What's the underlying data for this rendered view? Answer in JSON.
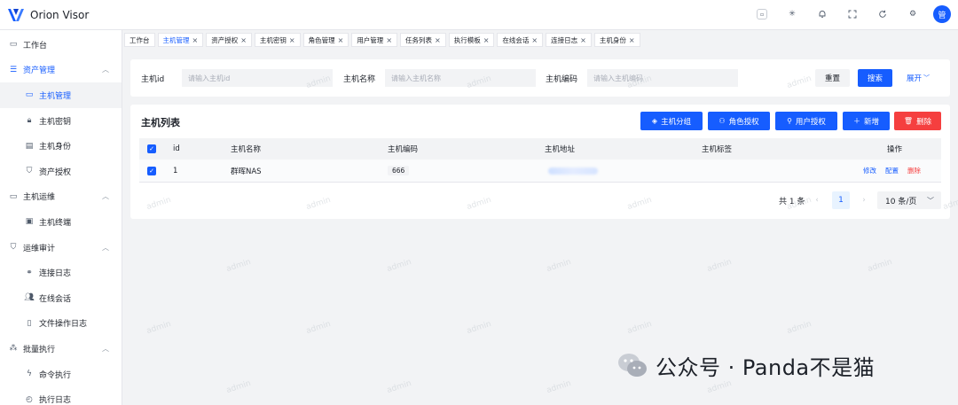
{
  "app": {
    "title": "Orion Visor",
    "avatar_text": "管",
    "brand_color": "#165dff"
  },
  "topbar_icons": [
    "window-icon",
    "sun-icon",
    "bell-icon",
    "fullscreen-icon",
    "refresh-icon",
    "gear-icon"
  ],
  "sidebar": {
    "workbench": "工作台",
    "asset_group": "资产管理",
    "asset_items": [
      "主机管理",
      "主机密钥",
      "主机身份",
      "资产授权"
    ],
    "ops_group": "主机运维",
    "ops_items": [
      "主机终端"
    ],
    "audit_group": "运维审计",
    "audit_items": [
      "连接日志",
      "在线会话",
      "文件操作日志"
    ],
    "batch_group": "批量执行",
    "batch_items": [
      "命令执行",
      "执行日志"
    ]
  },
  "tabs": [
    {
      "label": "工作台",
      "closable": false
    },
    {
      "label": "主机管理",
      "closable": true,
      "active": true
    },
    {
      "label": "资产授权",
      "closable": true
    },
    {
      "label": "主机密钥",
      "closable": true
    },
    {
      "label": "角色管理",
      "closable": true
    },
    {
      "label": "用户管理",
      "closable": true
    },
    {
      "label": "任务列表",
      "closable": true
    },
    {
      "label": "执行模板",
      "closable": true
    },
    {
      "label": "在线会话",
      "closable": true
    },
    {
      "label": "连接日志",
      "closable": true
    },
    {
      "label": "主机身份",
      "closable": true
    }
  ],
  "search": {
    "id_label": "主机id",
    "id_placeholder": "请输入主机id",
    "name_label": "主机名称",
    "name_placeholder": "请输入主机名称",
    "code_label": "主机编码",
    "code_placeholder": "请输入主机编码",
    "reset": "重置",
    "search": "搜索",
    "expand": "展开"
  },
  "list": {
    "title": "主机列表",
    "actions": {
      "group": "主机分组",
      "role_auth": "角色授权",
      "user_auth": "用户授权",
      "add": "新增",
      "delete": "删除"
    },
    "columns": {
      "id": "id",
      "name": "主机名称",
      "code": "主机编码",
      "address": "主机地址",
      "tags": "主机标签",
      "ops": "操作"
    },
    "rows": [
      {
        "id": "1",
        "name": "群晖NAS",
        "code": "666",
        "address": "",
        "tags": "",
        "ops": {
          "edit": "修改",
          "config": "配置",
          "delete": "删除"
        }
      }
    ]
  },
  "pagination": {
    "total": "共 1 条",
    "prev": "‹",
    "current": "1",
    "next": "›",
    "page_size": "10 条/页"
  },
  "watermark": "admin",
  "footer_watermark": "公众号 · Panda不是猫"
}
